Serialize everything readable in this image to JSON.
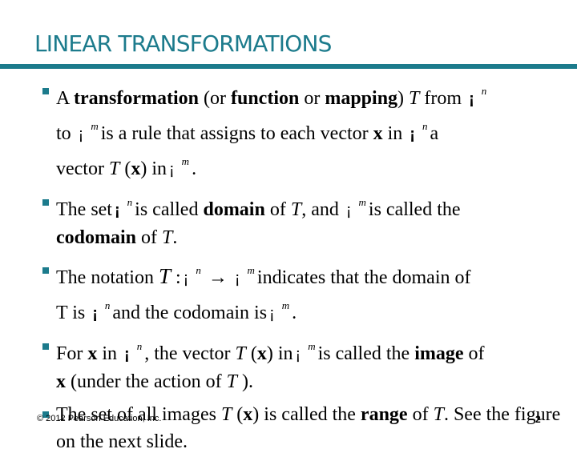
{
  "slide": {
    "title": "LINEAR TRANSFORMATIONS",
    "colors": {
      "accent": "#1c7b8c"
    },
    "bullets": [
      {
        "parts": {
          "p1": "A ",
          "p2": "transformation",
          "p3": " (or ",
          "p4": "function",
          "p5": " or ",
          "p6": "mapping",
          "p7": ") ",
          "p8": "T",
          "p9": " from ",
          "r1": "¡",
          "s1": "n",
          "p10": "to ",
          "r2": "¡",
          "s2": "m",
          "p11": "is a rule that assigns to each vector ",
          "p12": "x",
          "p13": " in ",
          "r3": "¡",
          "s3": "n",
          "p14": "a",
          "p15": "vector ",
          "p16": "T",
          "p17": " (",
          "p18": "x",
          "p19": ") in",
          "r4": "¡",
          "s4": "m",
          "p20": "."
        }
      },
      {
        "parts": {
          "p1": "The set",
          "r1": "¡",
          "s1": "n",
          "p2": "is called ",
          "p3": "domain",
          "p4": " of ",
          "p5": "T",
          "p6": ", and ",
          "r2": "¡",
          "s2": "m",
          "p7": "is called the",
          "p8": "codomain",
          "p9": " of ",
          "p10": "T",
          "p11": "."
        }
      },
      {
        "parts": {
          "p1": "The notation ",
          "p2": "T",
          "p3": " :",
          "r1": "¡",
          "s1": "n",
          "arrow": "→",
          "r2": "¡",
          "s2": "m",
          "p4": "indicates that the domain of",
          "p5": "T is ",
          "r3": "¡",
          "s3": "n",
          "p6": "and the codomain is",
          "r4": "¡",
          "s4": "m",
          "p7": "."
        }
      },
      {
        "parts": {
          "p1": "For ",
          "p2": "x",
          "p3": " in ",
          "r1": "¡",
          "s1": "n",
          "p4": ", the vector ",
          "p5": "T",
          "p6": " (",
          "p7": "x",
          "p8": ") in",
          "r2": "¡",
          "s2": "m",
          "p9": "is called the ",
          "p10": "image",
          "p11": " of",
          "p12": "x",
          "p13": " (under the action of ",
          "p14": "T",
          "p15": " )."
        }
      },
      {
        "parts": {
          "p1": "The set of all images ",
          "p2": "T",
          "p3": " (",
          "p4": "x",
          "p5": ") is called the ",
          "p6": "range",
          "p7": " of ",
          "p8": "T",
          "p9": ". See the figure on the next slide."
        }
      }
    ],
    "footer": {
      "copyright": "© 2012 Pearson Education, Inc.",
      "page_number": "2"
    }
  }
}
